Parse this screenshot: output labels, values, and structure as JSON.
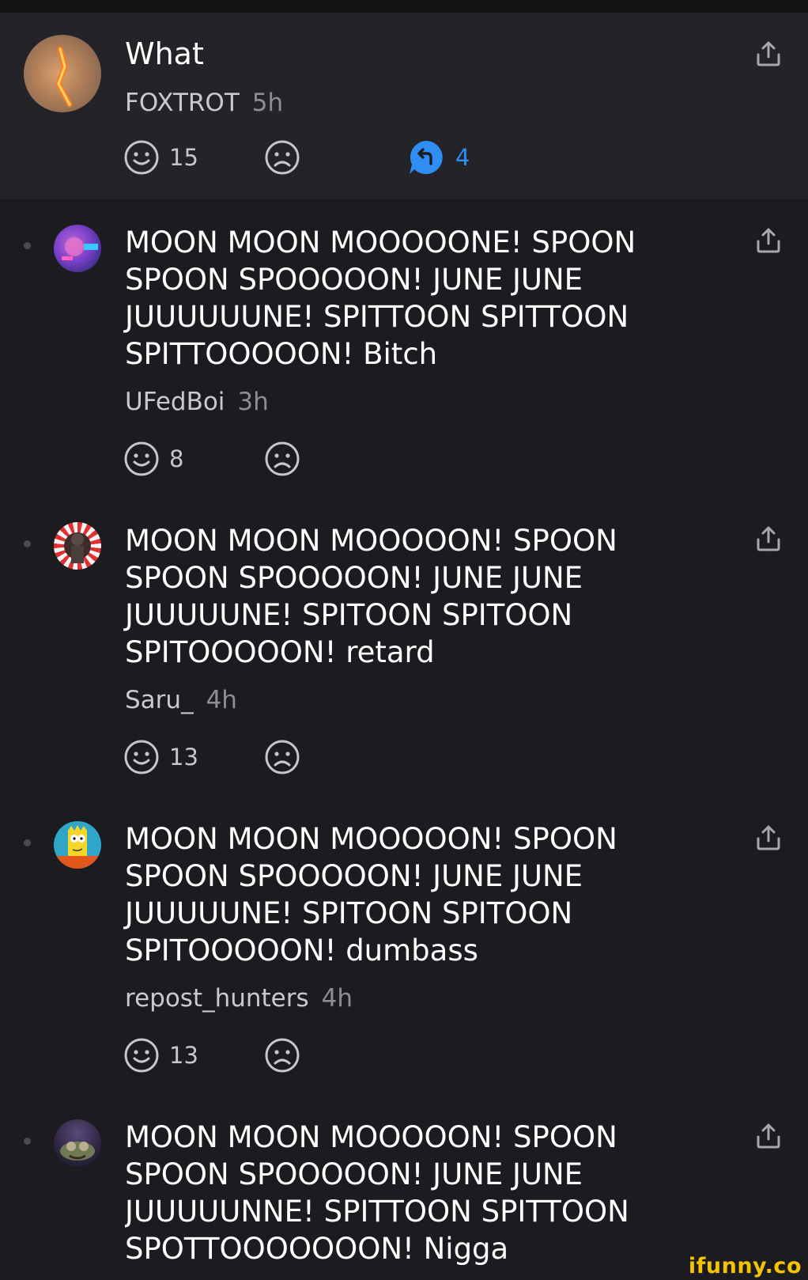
{
  "parent": {
    "text": "What",
    "user": "FOXTROT",
    "age": "5h",
    "smile_count": "15",
    "reply_count": "4"
  },
  "comments": [
    {
      "text": "MOON MOON MOOOOONE! SPOON SPOON SPOOOOON! JUNE JUNE JUUUUUUNE! SPITTOON SPITTOON SPITTOOOOON! Bitch",
      "user": "UFedBoi",
      "age": "3h",
      "smile_count": "8"
    },
    {
      "text": "MOON MOON MOOOOON! SPOON SPOON SPOOOOON! JUNE JUNE JUUUUUNE! SPITOON SPITOON SPITOOOOON! retard",
      "user": "Saru_",
      "age": "4h",
      "smile_count": "13"
    },
    {
      "text": "MOON MOON MOOOOON! SPOON SPOON SPOOOOON! JUNE JUNE JUUUUUNE! SPITOON SPITOON SPITOOOOON! dumbass",
      "user": "repost_hunters",
      "age": "4h",
      "smile_count": "13"
    },
    {
      "text": "MOON MOON MOOOOON! SPOON SPOON SPOOOOON! JUNE JUNE JUUUUUNNE! SPITTOON SPITTOON SPOTTOOOOOOON! Nigga",
      "user": "",
      "age": "",
      "smile_count": ""
    }
  ],
  "icons": {
    "smile": "smile-icon",
    "frown": "frown-icon",
    "reply": "reply-icon",
    "share": "share-icon"
  },
  "colors": {
    "background": "#1b1b20",
    "parent_background": "#232328",
    "reply_accent": "#2e8ef5",
    "watermark": "#f5c400"
  },
  "watermark": "ifunny.co"
}
